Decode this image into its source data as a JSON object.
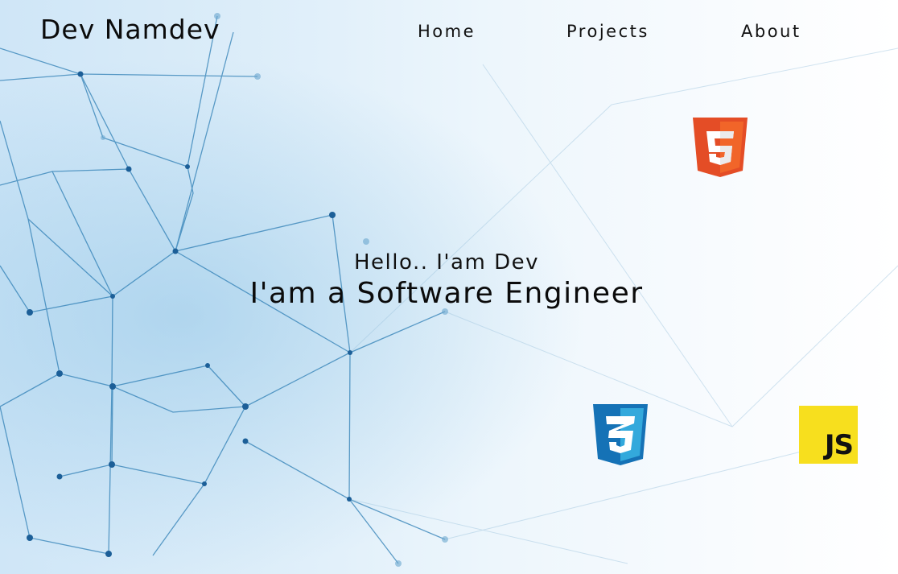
{
  "header": {
    "brand": "Dev Namdev",
    "nav": [
      {
        "label": "Home"
      },
      {
        "label": "Projects"
      },
      {
        "label": "About"
      }
    ]
  },
  "hero": {
    "greeting": "Hello.. I'am Dev",
    "title": "I'am a Software Engineer"
  },
  "tech_icons": [
    {
      "icon": "html5-icon",
      "color": "#e44d26"
    },
    {
      "icon": "css3-icon",
      "color": "#1572b6"
    },
    {
      "icon": "javascript-icon",
      "label": "JS",
      "color": "#f7df1e"
    }
  ]
}
